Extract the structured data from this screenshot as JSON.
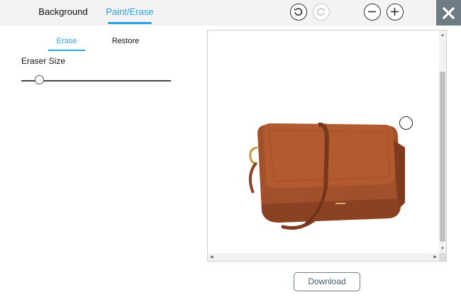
{
  "tabs": {
    "background": "Background",
    "paint_erase": "Paint/Erase"
  },
  "subtabs": {
    "erase": "Erase",
    "restore": "Restore"
  },
  "eraser": {
    "label": "Eraser Size",
    "size_fraction": 0.12
  },
  "toolbar": {
    "undo_icon": "undo-icon",
    "redo_icon": "redo-icon",
    "redo_enabled": false,
    "zoom_out_icon": "minus-icon",
    "zoom_in_icon": "plus-icon",
    "close_icon": "close-icon"
  },
  "canvas": {
    "image": "brown leather crossbody handbag",
    "background": "white"
  },
  "download": {
    "label": "Download"
  },
  "colors": {
    "accent": "#2b9fe0",
    "close_bg": "#6f7c83",
    "bag": "#a0502a"
  }
}
